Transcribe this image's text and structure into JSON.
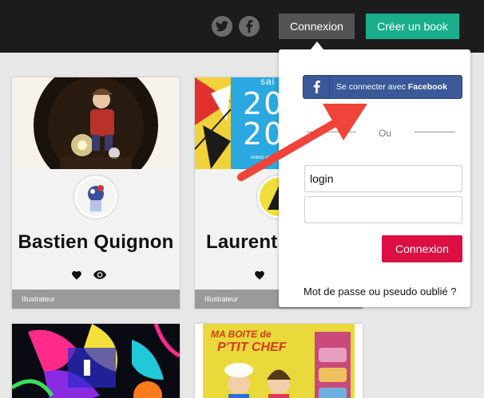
{
  "header": {
    "twitter_icon": "twitter-icon",
    "facebook_icon": "facebook-icon",
    "login_label": "Connexion",
    "create_label": "Créer un book"
  },
  "cards": [
    {
      "name": "Bastien Quignon",
      "role": "Illustrateur"
    },
    {
      "name": "Laurent I",
      "role": "Illustrateur",
      "cover_text_top": "sai",
      "cover_text_mid1": "20",
      "cover_text_mid2": "20",
      "cover_small": "entrez en"
    },
    {
      "name": "",
      "role": ""
    },
    {
      "name": "",
      "role": "",
      "cover_text_1": "MA BOITE de",
      "cover_text_2": "P'TIT CHEF"
    }
  ],
  "login_panel": {
    "facebook_button_prefix": "Se connecter avec ",
    "facebook_button_brand": "Facebook",
    "or_label": "Ou",
    "login_value": "login",
    "password_value": "",
    "submit_label": "Connexion",
    "forgot_label": "Mot de passe ou pseudo oublié ?"
  },
  "colors": {
    "topbar": "#1c1c1c",
    "create_button": "#1aae8d",
    "submit_button": "#dc0e44",
    "facebook": "#3b5998",
    "annotation_arrow": "#f0433a"
  }
}
